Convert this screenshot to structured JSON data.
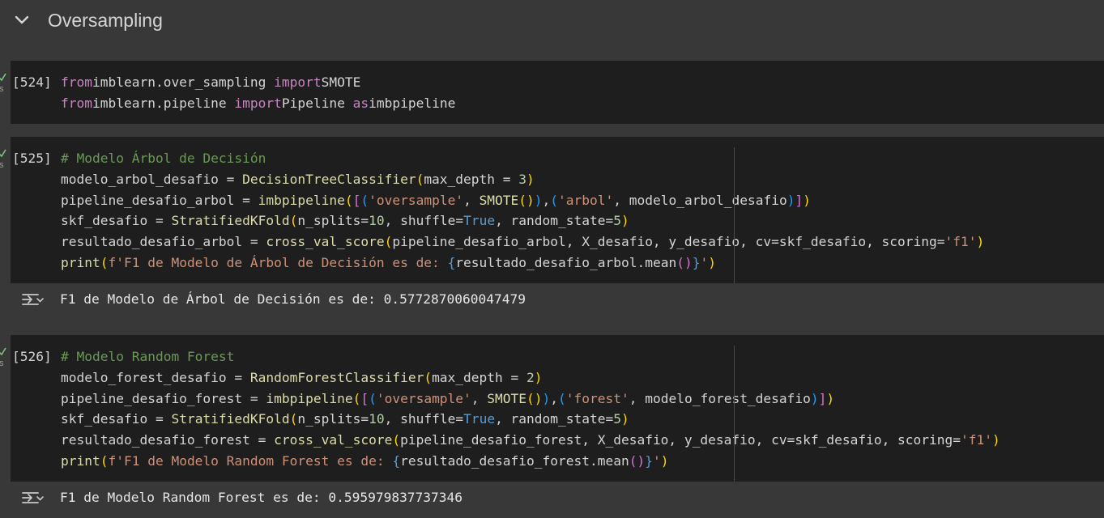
{
  "section": {
    "title": "Oversampling"
  },
  "cells": [
    {
      "count": "[524]",
      "status": "s",
      "lines": [
        [
          [
            "kw",
            "from"
          ],
          [
            "",
            "imblearn.over_sampling "
          ],
          [
            "kw",
            "import"
          ],
          [
            "",
            "SMOTE"
          ]
        ],
        [
          [
            "kw",
            "from"
          ],
          [
            "",
            "imblearn.pipeline "
          ],
          [
            "kw",
            "import"
          ],
          [
            "",
            "Pipeline "
          ],
          [
            "kw",
            "as"
          ],
          [
            "",
            "imbpipeline"
          ]
        ]
      ]
    },
    {
      "count": "[525]",
      "status": "s",
      "lines": [
        [
          [
            "cm",
            "# Modelo Árbol de Decisión"
          ]
        ],
        [
          [
            "",
            "modelo_arbol_desafio = "
          ],
          [
            "fn",
            "DecisionTreeClassifier"
          ],
          [
            "p1",
            "("
          ],
          [
            "",
            "max_depth = "
          ],
          [
            "num",
            "3"
          ],
          [
            "p1",
            ")"
          ]
        ],
        [
          [
            "",
            "pipeline_desafio_arbol = "
          ],
          [
            "fn",
            "imbpipeline"
          ],
          [
            "p1",
            "("
          ],
          [
            "p2",
            "["
          ],
          [
            "p3",
            "("
          ],
          [
            "str",
            "'oversample'"
          ],
          [
            "",
            ", "
          ],
          [
            "fn",
            "SMOTE"
          ],
          [
            "p1",
            "()"
          ],
          [
            "p3",
            ")"
          ],
          [
            "",
            ","
          ],
          [
            "p3",
            "("
          ],
          [
            "str",
            "'arbol'"
          ],
          [
            "",
            ", modelo_arbol_desafio"
          ],
          [
            "p3",
            ")"
          ],
          [
            "p2",
            "]"
          ],
          [
            "p1",
            ")"
          ]
        ],
        [
          [
            "",
            "skf_desafio = "
          ],
          [
            "fn",
            "StratifiedKFold"
          ],
          [
            "p1",
            "("
          ],
          [
            "",
            "n_splits="
          ],
          [
            "num",
            "10"
          ],
          [
            "",
            ", shuffle="
          ],
          [
            "kw2",
            "True"
          ],
          [
            "",
            ", random_state="
          ],
          [
            "num",
            "5"
          ],
          [
            "p1",
            ")"
          ]
        ],
        [
          [
            "",
            "resultado_desafio_arbol = "
          ],
          [
            "fn",
            "cross_val_score"
          ],
          [
            "p1",
            "("
          ],
          [
            "",
            "pipeline_desafio_arbol, X_desafio, y_desafio, cv=skf_desafio, scoring="
          ],
          [
            "str",
            "'f1'"
          ],
          [
            "p1",
            ")"
          ]
        ],
        [
          [
            "fn",
            "print"
          ],
          [
            "p1",
            "("
          ],
          [
            "str",
            "f'F1 de Modelo de Árbol de Decisión es de: "
          ],
          [
            "kw2",
            "{"
          ],
          [
            "",
            "resultado_desafio_arbol.mean"
          ],
          [
            "p2",
            "()"
          ],
          [
            "kw2",
            "}"
          ],
          [
            "str",
            "'"
          ],
          [
            "p1",
            ")"
          ]
        ]
      ],
      "output": "F1 de Modelo de Árbol de Decisión es de: 0.5772870060047479"
    },
    {
      "count": "[526]",
      "status": "s",
      "lines": [
        [
          [
            "cm",
            "# Modelo Random Forest"
          ]
        ],
        [
          [
            "",
            "modelo_forest_desafio = "
          ],
          [
            "fn",
            "RandomForestClassifier"
          ],
          [
            "p1",
            "("
          ],
          [
            "",
            "max_depth = "
          ],
          [
            "num",
            "2"
          ],
          [
            "p1",
            ")"
          ]
        ],
        [
          [
            "",
            "pipeline_desafio_forest = "
          ],
          [
            "fn",
            "imbpipeline"
          ],
          [
            "p1",
            "("
          ],
          [
            "p2",
            "["
          ],
          [
            "p3",
            "("
          ],
          [
            "str",
            "'oversample'"
          ],
          [
            "",
            ", "
          ],
          [
            "fn",
            "SMOTE"
          ],
          [
            "p1",
            "()"
          ],
          [
            "p3",
            ")"
          ],
          [
            "",
            ","
          ],
          [
            "p3",
            "("
          ],
          [
            "str",
            "'forest'"
          ],
          [
            "",
            ", modelo_forest_desafio"
          ],
          [
            "p3",
            ")"
          ],
          [
            "p2",
            "]"
          ],
          [
            "p1",
            ")"
          ]
        ],
        [
          [
            "",
            "skf_desafio = "
          ],
          [
            "fn",
            "StratifiedKFold"
          ],
          [
            "p1",
            "("
          ],
          [
            "",
            "n_splits="
          ],
          [
            "num",
            "10"
          ],
          [
            "",
            ", shuffle="
          ],
          [
            "kw2",
            "True"
          ],
          [
            "",
            ", random_state="
          ],
          [
            "num",
            "5"
          ],
          [
            "p1",
            ")"
          ]
        ],
        [
          [
            "",
            "resultado_desafio_forest = "
          ],
          [
            "fn",
            "cross_val_score"
          ],
          [
            "p1",
            "("
          ],
          [
            "",
            "pipeline_desafio_forest, X_desafio, y_desafio, cv=skf_desafio, scoring="
          ],
          [
            "str",
            "'f1'"
          ],
          [
            "p1",
            ")"
          ]
        ],
        [
          [
            "fn",
            "print"
          ],
          [
            "p1",
            "("
          ],
          [
            "str",
            "f'F1 de Modelo Random Forest es de: "
          ],
          [
            "kw2",
            "{"
          ],
          [
            "",
            "resultado_desafio_forest.mean"
          ],
          [
            "p2",
            "()"
          ],
          [
            "kw2",
            "}"
          ],
          [
            "str",
            "'"
          ],
          [
            "p1",
            ")"
          ]
        ]
      ],
      "output": "F1 de Modelo Random Forest es de: 0.595979837737346"
    }
  ],
  "colors": {
    "page_bg": "#383838",
    "cell_bg": "#1e1e1e",
    "check": "#7cc47f"
  },
  "icons": {
    "section_toggle": "chevron-down-icon",
    "output_toggle": "output-toggle-icon",
    "run_status": "check-icon"
  }
}
